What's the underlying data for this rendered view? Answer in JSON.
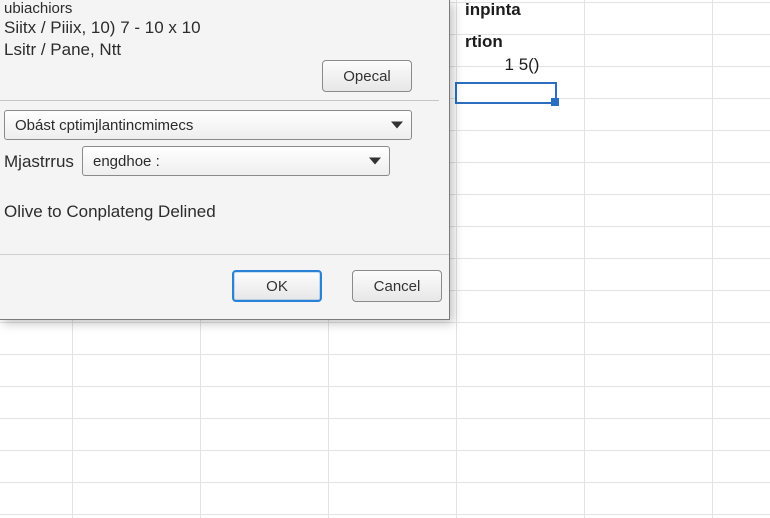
{
  "sheet": {
    "hdr1": "inpinta",
    "hdr2": "rtion",
    "cell_value": "1 5()"
  },
  "dialog": {
    "section_label": "ubiachiors",
    "line1": "Siitx / Piiix,  10) 7 - 10 x 10",
    "line2": "Lsitr / Pane, Ntt",
    "opecal_btn": "Opecal",
    "combo1_value": "Obást cptimjlantincmimecs",
    "combo2_label": "Mjastrrus",
    "combo2_value": "engdhoe :",
    "footer_text": "Olive to Conplateng Delined",
    "ok": "OK",
    "cancel": "Cancel"
  }
}
